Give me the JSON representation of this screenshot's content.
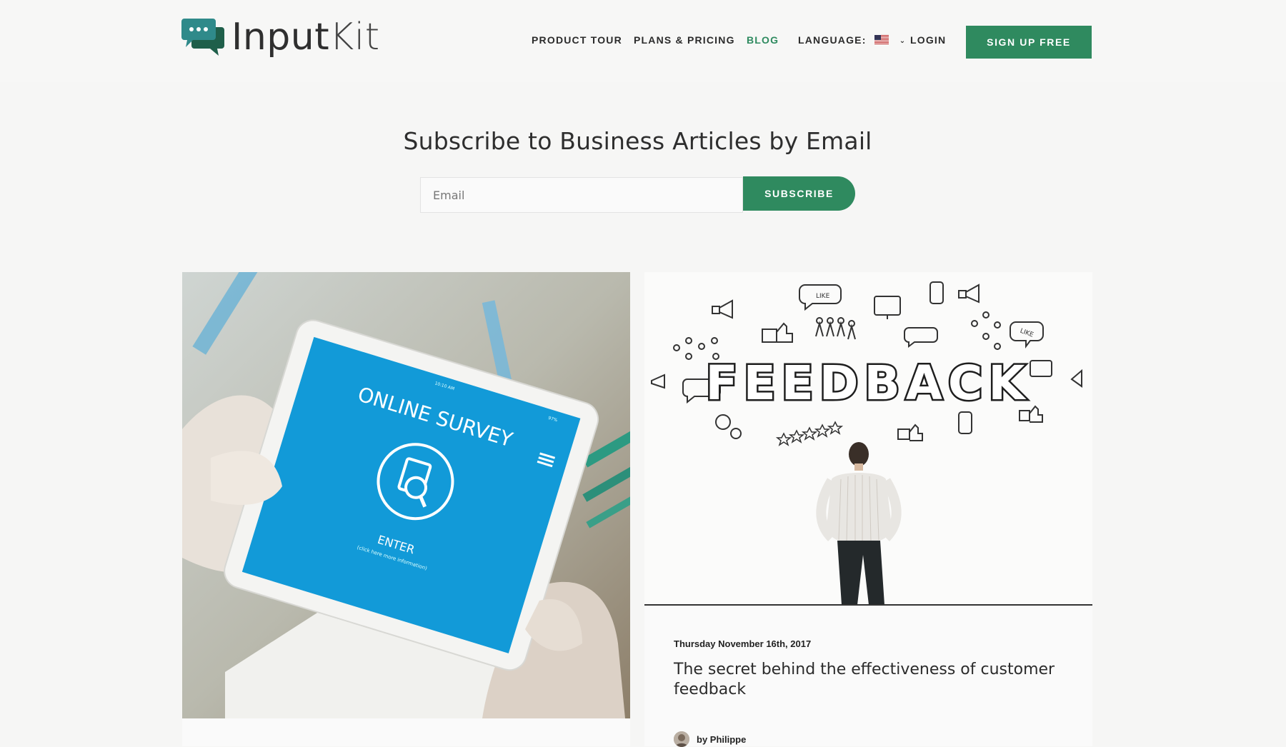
{
  "brand": {
    "name_a": "Input",
    "name_b": "Kit",
    "color": "#2f8a5f"
  },
  "nav": {
    "items": [
      {
        "label": "PRODUCT TOUR"
      },
      {
        "label": "PLANS & PRICING"
      },
      {
        "label": "BLOG",
        "active": true
      },
      {
        "label": "LANGUAGE:"
      },
      {
        "label": "LOGIN"
      }
    ],
    "signup_label": "SIGN UP FREE"
  },
  "subscribe": {
    "title": "Subscribe to Business Articles by Email",
    "email_placeholder": "Email",
    "button_label": "SUBSCRIBE"
  },
  "cards": [
    {
      "image": {
        "screen_title": "ONLINE SURVEY",
        "screen_enter": "ENTER",
        "screen_sub": "(click here more information)",
        "screen_time": "10:10 AM",
        "screen_battery": "97%"
      }
    },
    {
      "image": {
        "headline": "FEEDBACK",
        "bubble_1": "LIKE",
        "bubble_2": "LIKE"
      },
      "date": "Thursday November 16th, 2017",
      "title": "The secret behind the effectiveness of customer feedback",
      "author": "by Philippe"
    }
  ],
  "icons": {
    "logo": "chat-bubbles-icon",
    "flag": "us-flag-icon",
    "chevron": "chevron-down-icon",
    "avatar": "author-avatar"
  }
}
